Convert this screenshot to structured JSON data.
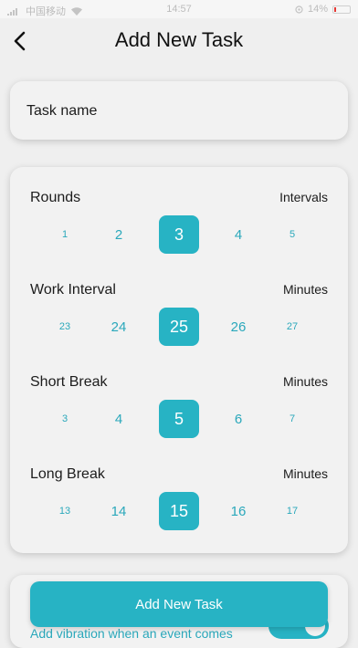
{
  "status_bar": {
    "carrier": "中国移动",
    "time": "14:57",
    "battery": "14%",
    "battery_level": 0.14
  },
  "header": {
    "title": "Add New Task",
    "back_icon": "chevron-left-icon"
  },
  "task_name": {
    "placeholder": "Task name",
    "value": ""
  },
  "sections": [
    {
      "label": "Rounds",
      "unit": "Intervals",
      "options": [
        "1",
        "2",
        "3",
        "4",
        "5"
      ],
      "selected": "3"
    },
    {
      "label": "Work Interval",
      "unit": "Minutes",
      "options": [
        "23",
        "24",
        "25",
        "26",
        "27"
      ],
      "selected": "25"
    },
    {
      "label": "Short Break",
      "unit": "Minutes",
      "options": [
        "3",
        "4",
        "5",
        "6",
        "7"
      ],
      "selected": "5"
    },
    {
      "label": "Long Break",
      "unit": "Minutes",
      "options": [
        "13",
        "14",
        "15",
        "16",
        "17"
      ],
      "selected": "15"
    }
  ],
  "vibration": {
    "label": "Add vibration when an event comes",
    "enabled": true
  },
  "add_button": {
    "label": "Add New Task"
  },
  "colors": {
    "accent": "#27b3c4",
    "accent_text": "#2aa8bb",
    "background": "#efefef",
    "battery_low": "#e53935"
  }
}
